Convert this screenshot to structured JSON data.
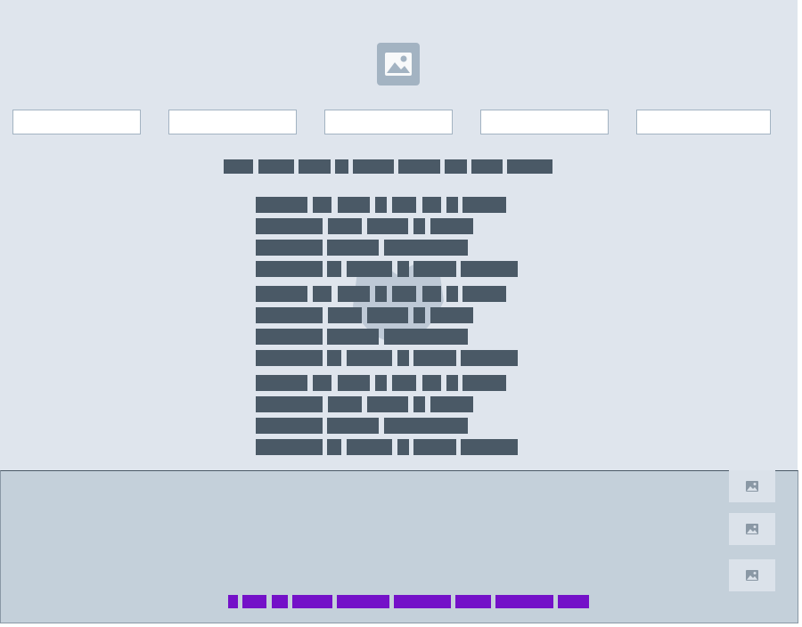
{
  "hero": {
    "icon": "image-placeholder-icon"
  },
  "fields": [
    {
      "value": ""
    },
    {
      "value": ""
    },
    {
      "value": ""
    },
    {
      "value": ""
    },
    {
      "value": ""
    }
  ],
  "watermark_icon": "translucent-graphic-icon",
  "thumbnails": [
    {
      "icon": "image-icon"
    },
    {
      "icon": "image-icon"
    },
    {
      "icon": "image-icon"
    }
  ],
  "colors": {
    "page_background": "#dfe5ed",
    "text_block": "#4a5966",
    "panel_background": "#c4d0da",
    "link": "#7411c8",
    "icon": "#a3b3c2"
  }
}
